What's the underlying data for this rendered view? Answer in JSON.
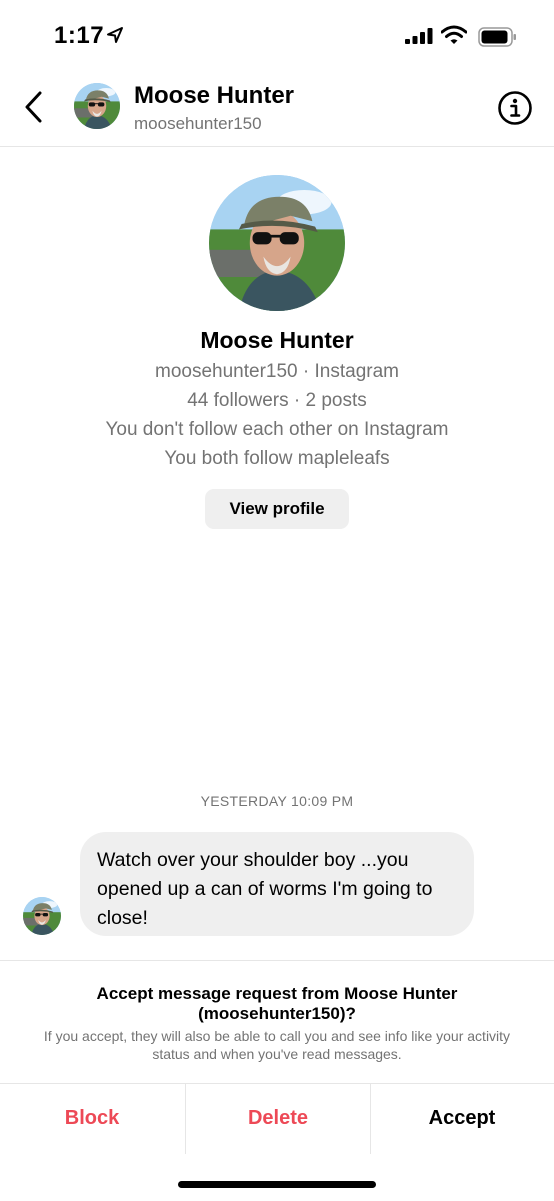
{
  "status_bar": {
    "time": "1:17"
  },
  "header": {
    "name": "Moose Hunter",
    "username": "moosehunter150"
  },
  "profile": {
    "name": "Moose Hunter",
    "handle_line": "moosehunter150 · Instagram",
    "stats_line": "44 followers · 2 posts",
    "follow_line": "You don't follow each other on Instagram",
    "mutual_line": "You both follow mapleleafs",
    "view_button": "View profile"
  },
  "thread": {
    "timestamp": "YESTERDAY 10:09 PM",
    "messages": [
      {
        "text": "Watch over your shoulder boy ...you opened up a can of worms I'm going to close!"
      }
    ]
  },
  "request": {
    "title": "Accept message request from Moose Hunter (moosehunter150)?",
    "subtitle": "If you accept, they will also be able to call you and see info like your activity status and when you've read messages.",
    "actions": {
      "block": "Block",
      "delete": "Delete",
      "accept": "Accept"
    }
  },
  "colors": {
    "destructive": "#ed4956",
    "secondary_text": "#737373",
    "bubble": "#efefef"
  },
  "icons": [
    "location-arrow-icon",
    "cellular-signal-icon",
    "wifi-icon",
    "battery-icon",
    "back-chevron-icon",
    "info-icon"
  ]
}
